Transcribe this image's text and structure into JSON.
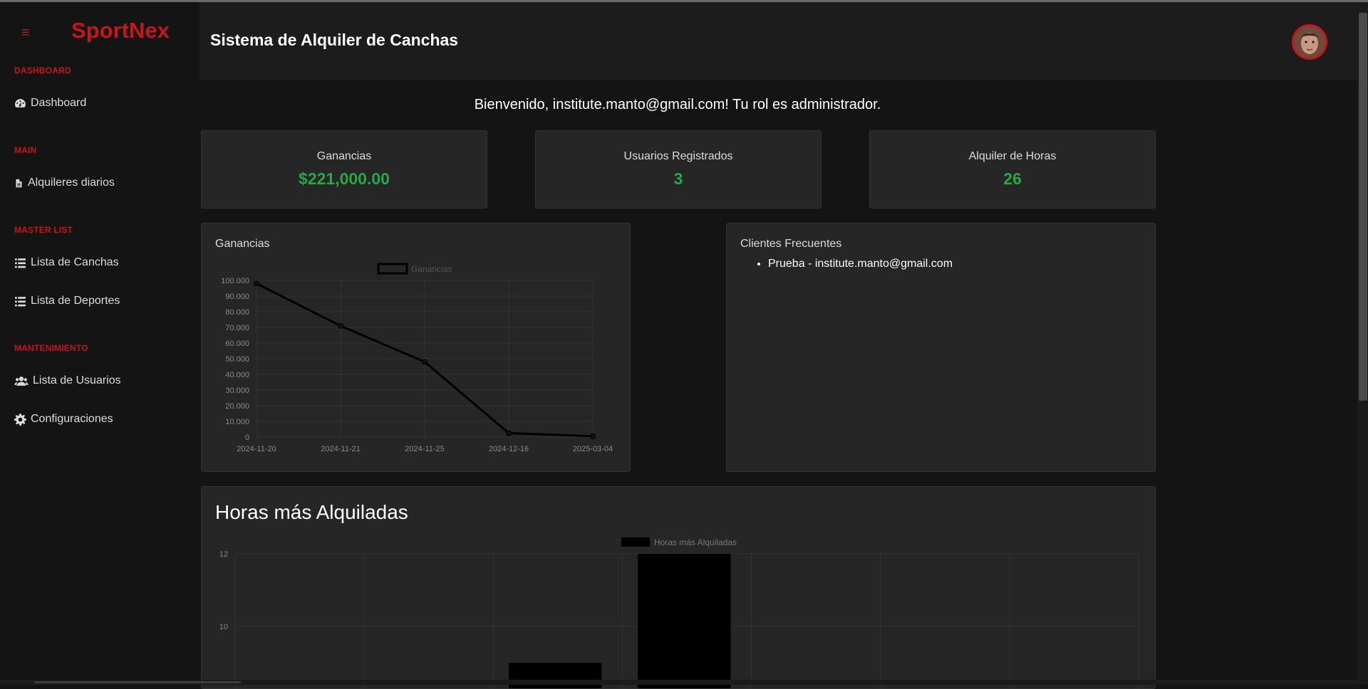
{
  "sidebar": {
    "hamburger": "≡",
    "brand": "SportNex",
    "sections": [
      {
        "heading": "DASHBOARD",
        "items": [
          {
            "label": "Dashboard",
            "icon": "tachometer-icon"
          }
        ]
      },
      {
        "heading": "MAIN",
        "items": [
          {
            "label": "Alquileres diarios",
            "icon": "file-icon"
          }
        ]
      },
      {
        "heading": "MASTER LIST",
        "items": [
          {
            "label": "Lista de Canchas",
            "icon": "list-icon"
          },
          {
            "label": "Lista de Deportes",
            "icon": "list-icon"
          }
        ]
      },
      {
        "heading": "MANTENIMIENTO",
        "items": [
          {
            "label": "Lista de Usuarios",
            "icon": "users-icon"
          },
          {
            "label": "Configuraciones",
            "icon": "gear-icon"
          }
        ]
      }
    ]
  },
  "header": {
    "title": "Sistema de Alquiler de Canchas"
  },
  "welcome": "Bienvenido, institute.manto@gmail.com! Tu rol es administrador.",
  "stats": [
    {
      "label": "Ganancias",
      "value": "$221,000.00"
    },
    {
      "label": "Usuarios Registrados",
      "value": "3"
    },
    {
      "label": "Alquiler de Horas",
      "value": "26"
    }
  ],
  "earnings_card": {
    "title": "Ganancias"
  },
  "clients_card": {
    "title": "Clientes Frecuentes",
    "items": [
      "Prueba - institute.manto@gmail.com"
    ]
  },
  "hours_card": {
    "title": "Horas más Alquiladas"
  },
  "colors": {
    "brand": "#c4161c",
    "value": "#28a745"
  },
  "chart_data": [
    {
      "type": "line",
      "legend": "Ganancias",
      "x": [
        "2024-11-20",
        "2024-11-21",
        "2024-11-25",
        "2024-12-16",
        "2025-03-04"
      ],
      "values": [
        98000,
        71000,
        48000,
        2500,
        500
      ],
      "yticks": [
        "100.000",
        "90.000",
        "80.000",
        "70.000",
        "60.000",
        "50.000",
        "40.000",
        "30.000",
        "20.000",
        "10.000",
        "0"
      ],
      "ylim": [
        0,
        100000
      ],
      "grid": true
    },
    {
      "type": "bar",
      "legend": "Horas más Alquiladas",
      "bar_count": 7,
      "values": [
        null,
        null,
        9,
        12,
        null,
        null,
        null
      ],
      "yticks": [
        "12",
        "10"
      ],
      "ylim_visible": [
        8.3,
        12
      ],
      "grid": true
    }
  ]
}
